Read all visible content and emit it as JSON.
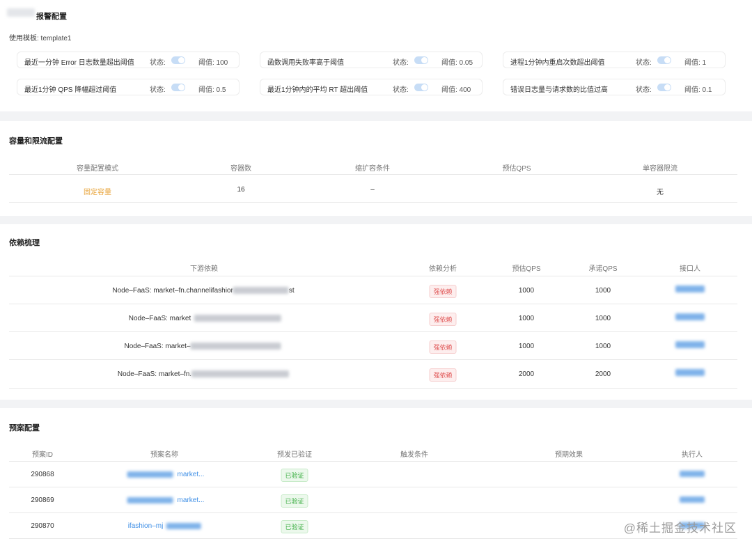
{
  "alarm": {
    "title": "报警配置",
    "template_label": "使用模板: template1",
    "rules": [
      {
        "text": "最近一分钟 Error 日志数量超出阈值",
        "status": "状态:",
        "threshold": "阈值: 100"
      },
      {
        "text": "函数调用失败率高于阈值",
        "status": "状态:",
        "threshold": "阈值: 0.05"
      },
      {
        "text": "进程1分钟内重启次数超出阈值",
        "status": "状态:",
        "threshold": "阈值: 1"
      },
      {
        "text": "最近1分钟 QPS 降幅超过阈值",
        "status": "状态:",
        "threshold": "阈值: 0.5"
      },
      {
        "text": "最近1分钟内的平均 RT 超出阈值",
        "status": "状态:",
        "threshold": "阈值: 400"
      },
      {
        "text": "错误日志量与请求数的比值过高",
        "status": "状态:",
        "threshold": "阈值: 0.1"
      }
    ]
  },
  "capacity": {
    "title": "容量和限流配置",
    "headers": [
      "容量配置模式",
      "容器数",
      "缩扩容条件",
      "预估QPS",
      "单容器限流"
    ],
    "row": [
      "固定容量",
      "16",
      "–",
      "",
      "无"
    ]
  },
  "deps": {
    "title": "依赖梳理",
    "headers": [
      "下游依赖",
      "依赖分析",
      "预估QPS",
      "承诺QPS",
      "接口人"
    ],
    "rows": [
      {
        "name": "Node–FaaS: market–fn.channelifashior",
        "suffix": "st",
        "tag": "强依赖",
        "est": "1000",
        "promise": "1000"
      },
      {
        "name": "Node–FaaS: market",
        "suffix": "",
        "tag": "强依赖",
        "est": "1000",
        "promise": "1000"
      },
      {
        "name": "Node–FaaS: market–",
        "suffix": "",
        "tag": "强依赖",
        "est": "1000",
        "promise": "1000"
      },
      {
        "name": "Node–FaaS: market–fn.",
        "suffix": "",
        "tag": "强依赖",
        "est": "2000",
        "promise": "2000"
      }
    ]
  },
  "plans": {
    "title": "预案配置",
    "headers": [
      "预案ID",
      "预案名称",
      "预发已验证",
      "触发条件",
      "预期效果",
      "执行人"
    ],
    "rows": [
      {
        "id": "290868",
        "name": "market...",
        "verified": "已验证"
      },
      {
        "id": "290869",
        "name": "market...",
        "verified": "已验证"
      },
      {
        "id": "290870",
        "name": "ifashion–mj",
        "verified": "已验证"
      }
    ]
  },
  "watermark": "@稀土掘金技术社区"
}
